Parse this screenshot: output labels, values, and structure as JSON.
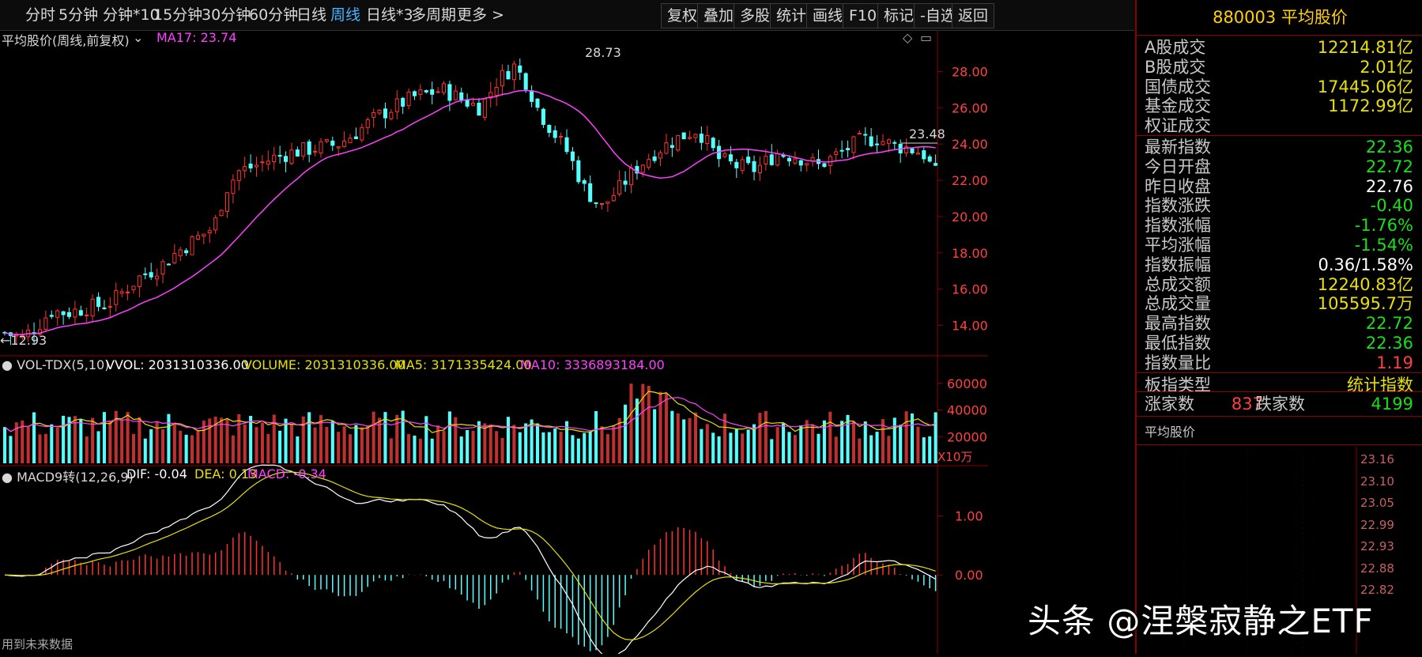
{
  "tabs": [
    {
      "label": "分时"
    },
    {
      "label": "5分钟"
    },
    {
      "label": "分钟*10"
    },
    {
      "label": "15分钟"
    },
    {
      "label": "30分钟"
    },
    {
      "label": "60分钟"
    },
    {
      "label": "日线"
    },
    {
      "label": "周线",
      "active": true
    },
    {
      "label": "日线*3"
    },
    {
      "label": "多周期"
    },
    {
      "label": "更多 >"
    }
  ],
  "toolbar": [
    "复权",
    "叠加",
    "多股",
    "统计",
    "画线",
    "F10",
    "标记",
    "-自选",
    "返回"
  ],
  "main_chart": {
    "title": "平均股价(周线,前复权)",
    "ma_label": "MA17: 23.74",
    "high_label": "28.73",
    "low_label": "12.93",
    "last_label": "23.48",
    "yaxis_ticks": [
      "28.00",
      "26.00",
      "24.00",
      "22.00",
      "20.00",
      "18.00",
      "16.00",
      "14.00"
    ],
    "ymin": 12.5,
    "ymax": 29.5
  },
  "volume_chart": {
    "title": "VOL-TDX(5,10)",
    "vvol": "VVOL: 2031310336.00",
    "volume": "VOLUME: 2031310336.00",
    "ma5": "MA5: 3171335424.00",
    "ma10": "MA10: 3336893184.00",
    "yaxis_ticks": [
      "60000",
      "40000",
      "20000"
    ],
    "unit": "X10万"
  },
  "macd_chart": {
    "title": "MACD9转(12,26,9)",
    "dif": "DIF: -0.04",
    "dea": "DEA: 0.13",
    "macd": "MACD: -0.34",
    "yaxis_ticks": [
      "1.00",
      "0.00"
    ],
    "footer": "用到未来数据"
  },
  "panel": {
    "title": "880003 平均股价",
    "rows": [
      {
        "label": "A股成交",
        "value": "12214.81亿",
        "color": "yellow"
      },
      {
        "label": "B股成交",
        "value": "2.01亿",
        "color": "yellow"
      },
      {
        "label": "国债成交",
        "value": "17445.06亿",
        "color": "yellow"
      },
      {
        "label": "基金成交",
        "value": "1172.99亿",
        "color": "yellow"
      },
      {
        "label": "权证成交",
        "value": "",
        "color": "yellow"
      },
      {
        "label": "最新指数",
        "value": "22.36",
        "color": "green"
      },
      {
        "label": "今日开盘",
        "value": "22.72",
        "color": "green"
      },
      {
        "label": "昨日收盘",
        "value": "22.76",
        "color": "white"
      },
      {
        "label": "指数涨跌",
        "value": "-0.40",
        "color": "green"
      },
      {
        "label": "指数涨幅",
        "value": "-1.76%",
        "color": "green"
      },
      {
        "label": "平均涨幅",
        "value": "-1.54%",
        "color": "green"
      },
      {
        "label": "指数振幅",
        "value": "0.36/1.58%",
        "color": "white"
      },
      {
        "label": "总成交额",
        "value": "12240.83亿",
        "color": "yellow"
      },
      {
        "label": "总成交量",
        "value": "105595.7万",
        "color": "yellow"
      },
      {
        "label": "最高指数",
        "value": "22.72",
        "color": "green"
      },
      {
        "label": "最低指数",
        "value": "22.36",
        "color": "green"
      },
      {
        "label": "指数量比",
        "value": "1.19",
        "color": "red"
      },
      {
        "label": "板指类型",
        "value": "统计指数",
        "color": "yellow"
      }
    ],
    "up_label": "涨家数",
    "up_count": "837",
    "down_label": "跌家数",
    "down_count": "4199",
    "mini_title": "平均股价",
    "mini_ticks": [
      "23.16",
      "23.10",
      "23.05",
      "22.99",
      "22.93",
      "22.88",
      "22.82"
    ]
  },
  "watermark": "头条 @涅槃寂静之ETF",
  "colors": {
    "up": "#ff3232",
    "down": "#54ffff",
    "ma": "#ff40ff",
    "yellow": "#e8e000",
    "axis": "#8b0000"
  }
}
